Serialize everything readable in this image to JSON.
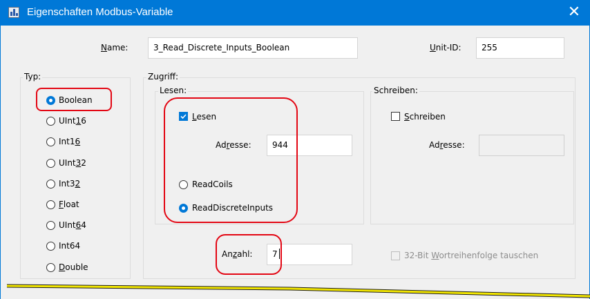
{
  "window": {
    "title": "Eigenschaften Modbus-Variable",
    "close_glyph": "✕",
    "icon": "modbus-app-icon"
  },
  "name": {
    "label": "Name:",
    "underline": "N",
    "rest": "ame:",
    "value": "3_Read_Discrete_Inputs_Boolean"
  },
  "unit_id": {
    "label": "Unit-ID:",
    "underline": "U",
    "rest": "nit-ID:",
    "value": "255"
  },
  "typ": {
    "legend": "Typ:",
    "options": [
      {
        "pre": "Boolean",
        "u": "",
        "post": "",
        "checked": true
      },
      {
        "pre": "UInt",
        "u": "1",
        "post": "6",
        "checked": false
      },
      {
        "pre": "Int1",
        "u": "6",
        "post": "",
        "checked": false
      },
      {
        "pre": "UInt",
        "u": "3",
        "post": "2",
        "checked": false
      },
      {
        "pre": "Int3",
        "u": "2",
        "post": "",
        "checked": false
      },
      {
        "pre": "",
        "u": "F",
        "post": "loat",
        "checked": false
      },
      {
        "pre": "UInt",
        "u": "6",
        "post": "4",
        "checked": false
      },
      {
        "pre": "Int64",
        "u": "",
        "post": "",
        "checked": false
      },
      {
        "pre": "",
        "u": "D",
        "post": "ouble",
        "checked": false
      }
    ]
  },
  "zugriff": {
    "legend": "Zugriff:",
    "lesen": {
      "legend": "Lesen:",
      "checkbox": {
        "u": "L",
        "post": "esen",
        "checked": true
      },
      "adresse": {
        "pre": "Ad",
        "u": "r",
        "post": "esse:",
        "value": "944"
      },
      "read_coils": {
        "label": "ReadCoils",
        "checked": false
      },
      "read_discrete_inputs": {
        "label": "ReadDiscreteInputs",
        "checked": true
      }
    },
    "schreiben": {
      "legend": "Schreiben:",
      "checkbox": {
        "u": "S",
        "post": "chreiben",
        "checked": false
      },
      "adresse": {
        "pre": "Ad",
        "u": "r",
        "post": "esse:",
        "value": ""
      }
    },
    "anzahl": {
      "pre": "An",
      "u": "z",
      "post": "ahl:",
      "value": "7"
    },
    "wortreihenfolge": {
      "pre": "32-Bit ",
      "u": "W",
      "post": "ortreihenfolge tauschen",
      "checked": false,
      "enabled": false
    }
  },
  "colors": {
    "title_bar": "#0078d7",
    "dialog_bg": "#f0f0f0",
    "annotation_red": "#e30613",
    "annotation_yellow": "#f2e600",
    "accent": "#0078d7"
  }
}
